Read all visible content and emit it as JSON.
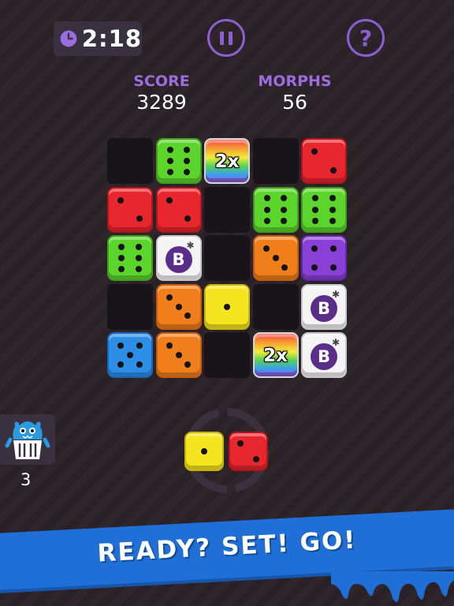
{
  "hud": {
    "timer": "2:18",
    "pause_icon": "pause-icon",
    "help_label": "?",
    "score_label": "SCORE",
    "score_value": "3289",
    "morphs_label": "MORPHS",
    "morphs_value": "56"
  },
  "colors": {
    "accent": "#8c5fd0",
    "banner": "#1f6fd6",
    "board_empty": "#191419"
  },
  "board": {
    "rows": 5,
    "cols": 5,
    "tiles": [
      {
        "row": 0,
        "col": 0,
        "type": "empty"
      },
      {
        "row": 0,
        "col": 1,
        "type": "die",
        "color": "green",
        "face": 6
      },
      {
        "row": 0,
        "col": 2,
        "type": "multiplier",
        "label": "2x"
      },
      {
        "row": 0,
        "col": 3,
        "type": "empty"
      },
      {
        "row": 0,
        "col": 4,
        "type": "die",
        "color": "red",
        "face": 2
      },
      {
        "row": 1,
        "col": 0,
        "type": "die",
        "color": "red",
        "face": 2
      },
      {
        "row": 1,
        "col": 1,
        "type": "die",
        "color": "red",
        "face": 2
      },
      {
        "row": 1,
        "col": 2,
        "type": "empty"
      },
      {
        "row": 1,
        "col": 3,
        "type": "die",
        "color": "green",
        "face": 6
      },
      {
        "row": 1,
        "col": 4,
        "type": "die",
        "color": "green",
        "face": 6
      },
      {
        "row": 2,
        "col": 0,
        "type": "die",
        "color": "green",
        "face": 6
      },
      {
        "row": 2,
        "col": 1,
        "type": "bomb",
        "label": "B"
      },
      {
        "row": 2,
        "col": 2,
        "type": "empty"
      },
      {
        "row": 2,
        "col": 3,
        "type": "die",
        "color": "orange",
        "face": 3
      },
      {
        "row": 2,
        "col": 4,
        "type": "die",
        "color": "purple",
        "face": 4
      },
      {
        "row": 3,
        "col": 0,
        "type": "empty"
      },
      {
        "row": 3,
        "col": 1,
        "type": "die",
        "color": "orange",
        "face": 3
      },
      {
        "row": 3,
        "col": 2,
        "type": "die",
        "color": "yellow",
        "face": 1
      },
      {
        "row": 3,
        "col": 3,
        "type": "empty"
      },
      {
        "row": 3,
        "col": 4,
        "type": "bomb",
        "label": "B"
      },
      {
        "row": 4,
        "col": 0,
        "type": "die",
        "color": "blue",
        "face": 5
      },
      {
        "row": 4,
        "col": 1,
        "type": "die",
        "color": "orange",
        "face": 3
      },
      {
        "row": 4,
        "col": 2,
        "type": "empty"
      },
      {
        "row": 4,
        "col": 3,
        "type": "multiplier",
        "label": "2x"
      },
      {
        "row": 4,
        "col": 4,
        "type": "bomb",
        "label": "B"
      }
    ]
  },
  "next_piece": [
    {
      "color": "yellow",
      "face": 1
    },
    {
      "color": "red",
      "face": 2
    }
  ],
  "monster": {
    "icon": "trash-monster-icon",
    "count": "3"
  },
  "banner": {
    "text": "READY? SET! GO!"
  }
}
